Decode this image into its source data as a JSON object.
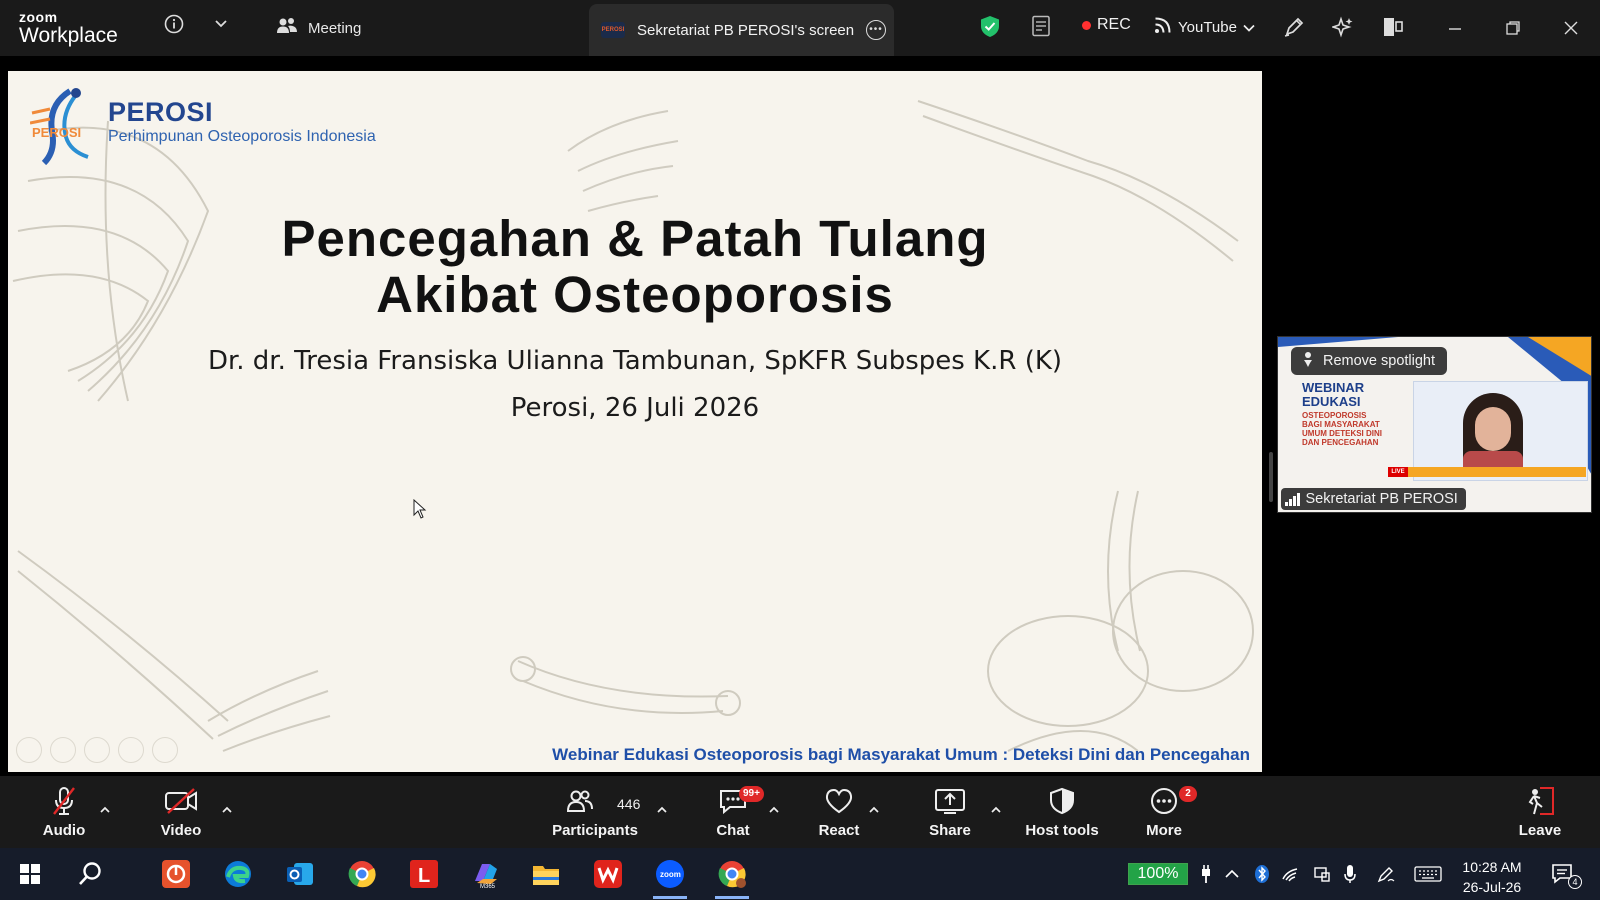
{
  "app": {
    "brand_small": "zoom",
    "brand_large": "Workplace"
  },
  "topbar": {
    "meeting_label": "Meeting",
    "share_tab_label": "Sekretariat PB PEROSI's screen",
    "rec_label": "REC",
    "stream_label": "YouTube"
  },
  "slide": {
    "org_name": "PEROSI",
    "org_full": "Perhimpunan Osteoporosis Indonesia",
    "title_line1": "Pencegahan & Patah Tulang",
    "title_line2": "Akibat Osteoporosis",
    "presenter": "Dr. dr. Tresia Fransiska Ulianna Tambunan, SpKFR Subspes K.R (K)",
    "date": "Perosi, 26 Juli 2026",
    "footer": "Webinar Edukasi Osteoporosis bagi Masyarakat Umum : Deteksi Dini dan Pencegahan"
  },
  "spotlight": {
    "remove_label": "Remove spotlight",
    "name": "Sekretariat PB PEROSI",
    "thumb_title": "WEBINAR EDUKASI",
    "thumb_sub": "OSTEOPOROSIS BAGI MASYARAKAT UMUM DETEKSI DINI DAN PENCEGAHAN",
    "live_label": "LIVE"
  },
  "toolbar": {
    "audio": "Audio",
    "video": "Video",
    "participants": "Participants",
    "participants_count": "446",
    "chat": "Chat",
    "chat_badge": "99+",
    "react": "React",
    "share": "Share",
    "host_tools": "Host tools",
    "more": "More",
    "more_badge": "2",
    "leave": "Leave"
  },
  "taskbar": {
    "battery": "100%",
    "time": "10:28 AM",
    "date": "26-Jul-26",
    "notification_count": "4"
  },
  "colors": {
    "accent_red": "#e02828",
    "slide_bg": "#f7f4ed",
    "perosi_blue": "#23468f",
    "security_green": "#23c16b"
  }
}
